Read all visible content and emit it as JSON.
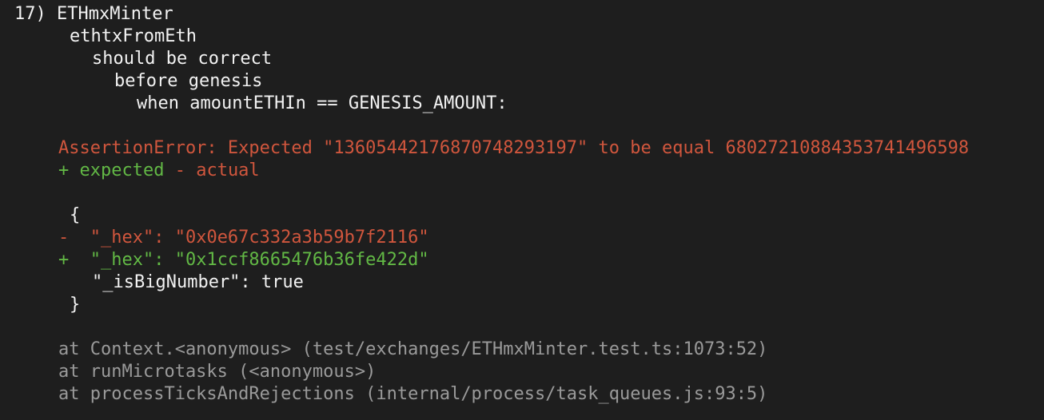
{
  "test": {
    "number": "17)",
    "suite": "ETHmxMinter",
    "describe_1": "ethtxFromEth",
    "describe_2": "should be correct",
    "describe_3": "before genesis",
    "describe_4": "when amountETHIn == GENESIS_AMOUNT:"
  },
  "error": {
    "message": "AssertionError: Expected \"1360544217687074829319​7\" to be equal 6802721088435374149659​8",
    "legend_expected": "+ expected",
    "legend_separator": " - ",
    "legend_actual": "actual"
  },
  "diff": {
    "open_brace": "{",
    "removed_marker": "-",
    "removed_line": "\"_hex\": \"0x0e67c332a3b59b7f2116\"",
    "added_marker": "+",
    "added_line": "\"_hex\": \"0x1ccf8665476b36fe422d\"",
    "context_line": "\"_isBigNumber\": true",
    "close_brace": "}"
  },
  "stack": [
    "at Context.<anonymous> (test/exchanges/ETHmxMinter.test.ts:1073:52)",
    "at runMicrotasks (<anonymous>)",
    "at processTicksAndRejections (internal/process/task_queues.js:93:5)"
  ],
  "colors": {
    "background": "#1e1e1e",
    "text": "#f2f2f2",
    "error_red": "#d0563d",
    "diff_green": "#62b845",
    "stack_grey": "#9a9a9a"
  }
}
